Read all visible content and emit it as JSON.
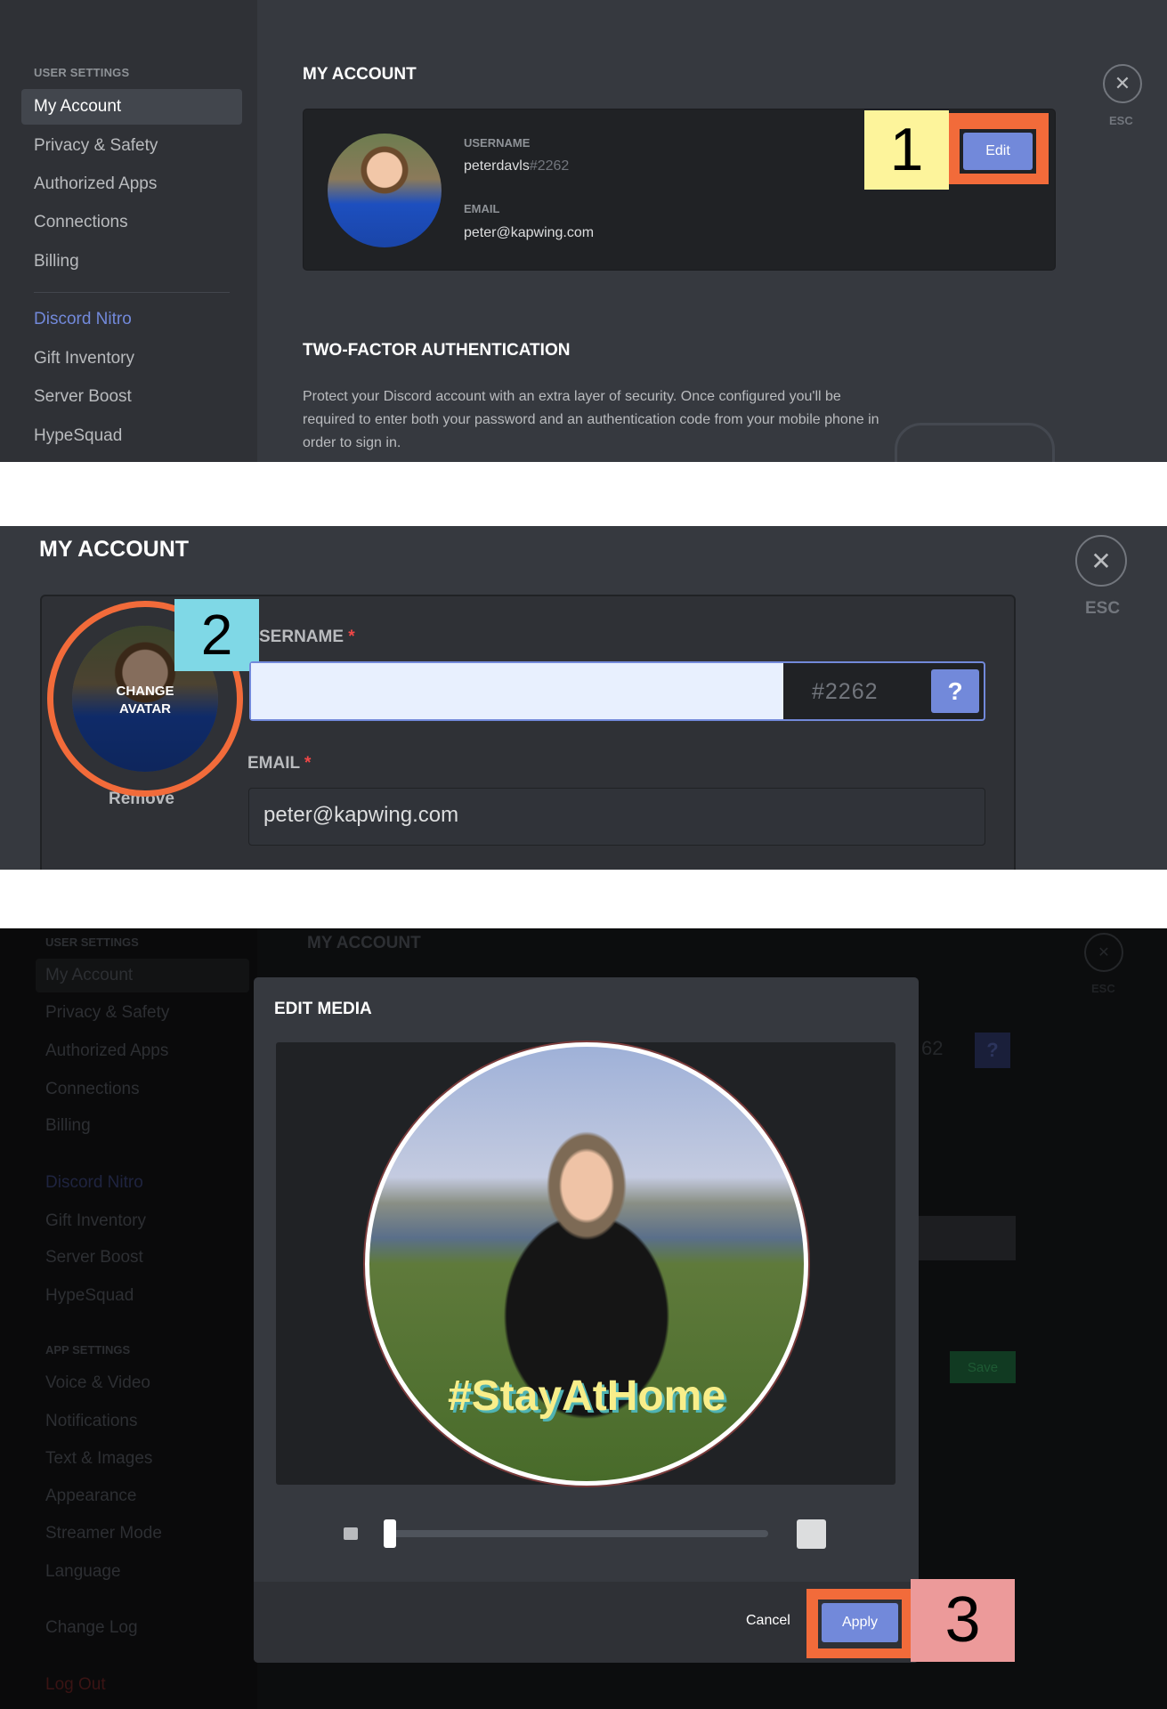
{
  "panel1": {
    "sidebar": {
      "header": "USER SETTINGS",
      "items": [
        "My Account",
        "Privacy & Safety",
        "Authorized Apps",
        "Connections",
        "Billing"
      ],
      "nitro": "Discord Nitro",
      "items2": [
        "Gift Inventory",
        "Server Boost",
        "HypeSquad"
      ]
    },
    "title": "MY ACCOUNT",
    "card": {
      "username_label": "USERNAME",
      "username": "peterdavls",
      "discriminator": "#2262",
      "email_label": "EMAIL",
      "email": "peter@kapwing.com",
      "edit": "Edit"
    },
    "step": "1",
    "esc": "ESC",
    "twofa": {
      "title": "TWO-FACTOR AUTHENTICATION",
      "text": "Protect your Discord account with an extra layer of security. Once configured you'll be required to enter both your password and an authentication code from your mobile phone in order to sign in."
    }
  },
  "panel2": {
    "title": "MY ACCOUNT",
    "esc": "ESC",
    "step": "2",
    "change_avatar": "CHANGE AVATAR",
    "remove": "Remove",
    "username_label": "SERNAME",
    "required": "*",
    "username_value": "",
    "discriminator": "#2262",
    "help": "?",
    "email_label": "EMAIL",
    "email_value": "peter@kapwing.com"
  },
  "panel3": {
    "background": {
      "user_settings": "USER SETTINGS",
      "items": [
        "My Account",
        "Privacy & Safety",
        "Authorized Apps",
        "Connections",
        "Billing"
      ],
      "nitro": "Discord Nitro",
      "items2": [
        "Gift Inventory",
        "Server Boost",
        "HypeSquad"
      ],
      "app_settings": "APP SETTINGS",
      "items3": [
        "Voice & Video",
        "Notifications",
        "Text & Images",
        "Appearance",
        "Streamer Mode",
        "Language"
      ],
      "change_log": "Change Log",
      "log_out": "Log Out",
      "title": "MY ACCOUNT",
      "esc": "ESC",
      "partial": "62",
      "help": "?",
      "save": "Save"
    },
    "modal": {
      "title": "EDIT MEDIA",
      "overlay_text": "#StayAtHome",
      "zoom_level": 0,
      "cancel": "Cancel",
      "apply": "Apply"
    },
    "step": "3"
  },
  "colors": {
    "accent": "#7289da",
    "highlight_orange": "#f26b3a",
    "step1": "#fdf49b",
    "step2": "#7fd8e6",
    "step3": "#ec9a9a"
  }
}
